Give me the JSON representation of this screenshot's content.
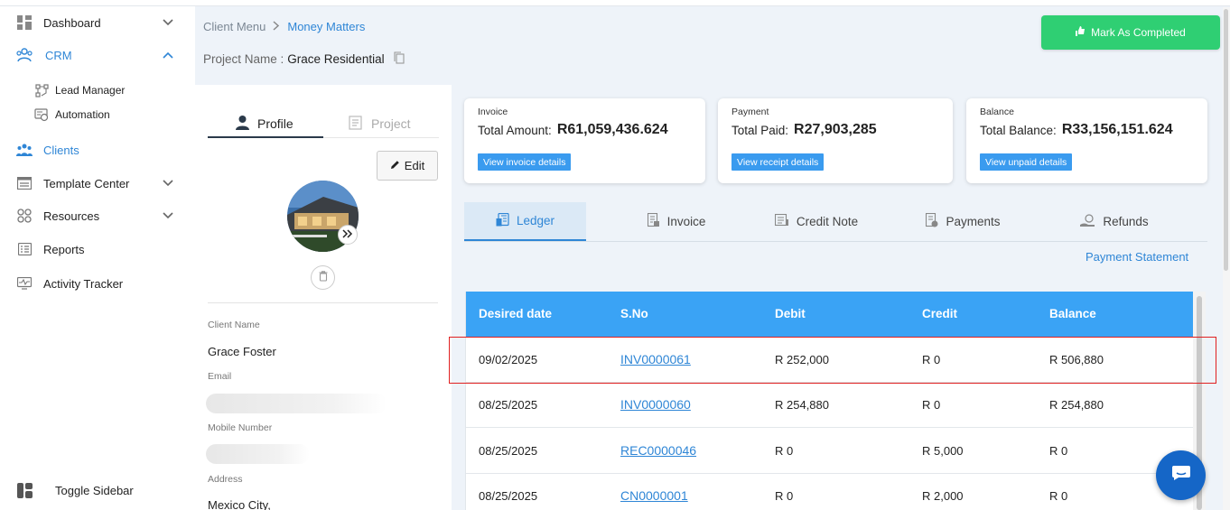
{
  "sidebar": {
    "items": [
      {
        "label": "Dashboard"
      },
      {
        "label": "CRM"
      },
      {
        "label": "Lead Manager"
      },
      {
        "label": "Automation"
      },
      {
        "label": "Clients"
      },
      {
        "label": "Template Center"
      },
      {
        "label": "Resources"
      },
      {
        "label": "Reports"
      },
      {
        "label": "Activity Tracker"
      }
    ],
    "toggle_label": "Toggle Sidebar"
  },
  "breadcrumb": {
    "parent": "Client Menu",
    "sep": ">",
    "current": "Money Matters"
  },
  "project": {
    "label": "Project Name :",
    "name": "Grace Residential"
  },
  "mark_completed_label": "Mark As Completed",
  "profile": {
    "tabs": [
      "Profile",
      "Project"
    ],
    "edit_label": "Edit",
    "fields": {
      "client_name_label": "Client Name",
      "client_name": "Grace Foster",
      "email_label": "Email",
      "mobile_label": "Mobile Number",
      "address_label": "Address",
      "address": "Mexico City,"
    }
  },
  "cards": [
    {
      "kind": "Invoice",
      "label": "Total Amount:",
      "value": "R61,059,436.624",
      "link": "View invoice details"
    },
    {
      "kind": "Payment",
      "label": "Total Paid:",
      "value": "R27,903,285",
      "link": "View receipt details"
    },
    {
      "kind": "Balance",
      "label": "Total Balance:",
      "value": "R33,156,151.624",
      "link": "View unpaid details"
    }
  ],
  "tabs": [
    "Ledger",
    "Invoice",
    "Credit Note",
    "Payments",
    "Refunds"
  ],
  "payment_statement_label": "Payment Statement",
  "table": {
    "headers": [
      "Desired date",
      "S.No",
      "Debit",
      "Credit",
      "Balance"
    ],
    "rows": [
      {
        "date": "09/02/2025",
        "sno": "INV0000061",
        "debit": "R 252,000",
        "credit": "R 0",
        "balance": "R 506,880"
      },
      {
        "date": "08/25/2025",
        "sno": "INV0000060",
        "debit": "R 254,880",
        "credit": "R 0",
        "balance": "R 254,880"
      },
      {
        "date": "08/25/2025",
        "sno": "REC0000046",
        "debit": "R 0",
        "credit": "R 5,000",
        "balance": "R 0"
      },
      {
        "date": "08/25/2025",
        "sno": "CN0000001",
        "debit": "R 0",
        "credit": "R 2,000",
        "balance": "R 0"
      }
    ]
  },
  "colors": {
    "accent": "#2f86d6",
    "success": "#2fcf73",
    "table_header": "#3aa3f5",
    "chat": "#1566c7"
  }
}
